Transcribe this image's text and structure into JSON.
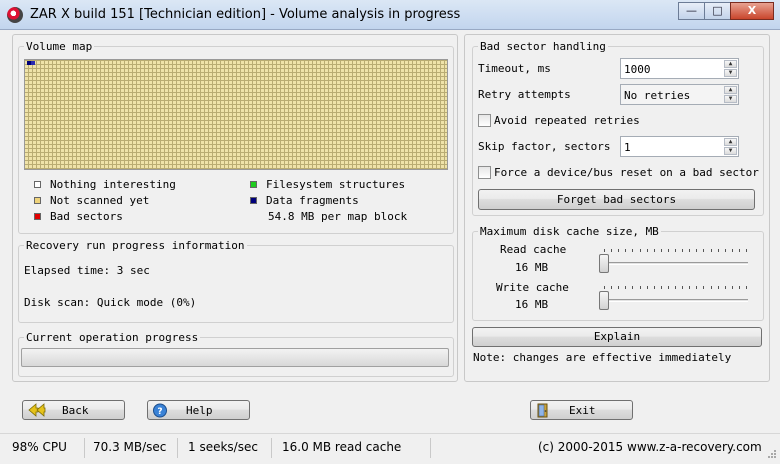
{
  "window": {
    "title": "ZAR X build 151 [Technician edition] - Volume analysis in progress",
    "minimize_label": "—",
    "maximize_label": "□",
    "close_label": "X"
  },
  "volume_map": {
    "label": "Volume map",
    "legend": {
      "nothing_interesting": "Nothing interesting",
      "not_scanned": "Not scanned yet",
      "bad_sectors": "Bad sectors",
      "filesystem": "Filesystem structures",
      "data_fragments": "Data fragments",
      "per_block": "54.8 MB per map block"
    },
    "colors": {
      "nothing_interesting": "#ffffff",
      "not_scanned": "#efd37a",
      "bad_sectors": "#e00000",
      "filesystem": "#1ecc1e",
      "data_fragments": "#00007a"
    }
  },
  "recovery": {
    "label": "Recovery run progress information",
    "elapsed": "Elapsed time: 3 sec",
    "disk_scan": "Disk scan: Quick mode (0%)"
  },
  "current_op": {
    "label": "Current operation progress",
    "progress": 0
  },
  "bad_sector": {
    "label": "Bad sector handling",
    "timeout_label": "Timeout, ms",
    "timeout_value": "1000",
    "retry_label": "Retry attempts",
    "retry_value": "No retries",
    "avoid_label": "Avoid repeated retries",
    "skip_label": "Skip factor, sectors",
    "skip_value": "1",
    "force_label": "Force a device/bus reset on a bad sector",
    "forget_button": "Forget bad sectors"
  },
  "cache": {
    "label": "Maximum disk cache size, MB",
    "read_label": "Read cache",
    "read_value": "16 MB",
    "write_label": "Write cache",
    "write_value": "16 MB"
  },
  "explain_button": "Explain",
  "note": "Note: changes are effective immediately",
  "buttons": {
    "back": "Back",
    "help": "Help",
    "exit": "Exit"
  },
  "status": {
    "cpu": "98% CPU",
    "speed": "70.3 MB/sec",
    "seeks": "1 seeks/sec",
    "cache": "16.0 MB read cache",
    "copyright": "(c) 2000-2015 www.z-a-recovery.com"
  }
}
